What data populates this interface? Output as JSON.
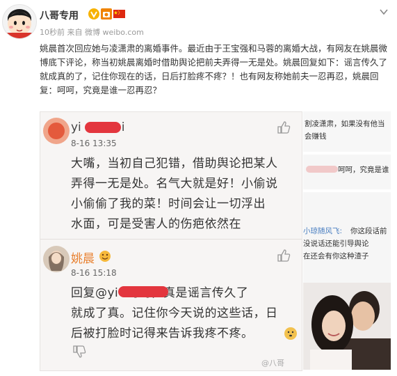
{
  "header": {
    "username": "八哥专用",
    "time": "10秒前",
    "source_prefix": "来自",
    "source": "微博 weibo.com"
  },
  "post": {
    "text": "姚晨首次回应她与凌潇肃的离婚事件。最近由于王宝强和马蓉的离婚大战，有网友在姚晨微博底下评论，称当初姚晨离婚时借助舆论把前夫弄得一无是处。姚晨回复如下：谣言传久了就成真的了，记住你现在的话，日后打脸疼不疼？！也有网友称她前夫一忍再忍，姚晨回复：呵呵，究竟是谁一忍再忍？"
  },
  "screenshot": {
    "comment1": {
      "user_prefix": "yi",
      "user_suffix": "i",
      "time": "8-16 13:35",
      "lines": [
        "大嘴，当初自己犯错，借助舆论把某人",
        "弄得一无是处。名气大就是好！小偷说",
        "小偷偷了我的菜！时间会让一切浮出",
        "水面，可是受害人的伤疤依然在"
      ]
    },
    "comment2": {
      "user": "姚晨",
      "time": "8-16 15:18",
      "lines": [
        "回复@yi          :呵呵，真是谣言传久了",
        "就成了真。记住你今天说的这些话，日",
        "后被打脸时记得来告诉我疼不疼。"
      ],
      "watermark": "@八哥"
    }
  },
  "side_images": {
    "img1_lines": [
      "割凌潇肃，如果没有他当",
      "会赚钱"
    ],
    "img2_line": "呵呵，究竟是谁",
    "img3_user": "小琼随风飞:",
    "img3_lines": [
      "你这段话前",
      "没说话还能引导舆论",
      "在还会有你这种渣子"
    ]
  },
  "icons": {
    "verified": "verified-v-icon",
    "level": "level-badge-icon",
    "flag": "china-flag-icon",
    "menu": "chevron-down-icon"
  }
}
